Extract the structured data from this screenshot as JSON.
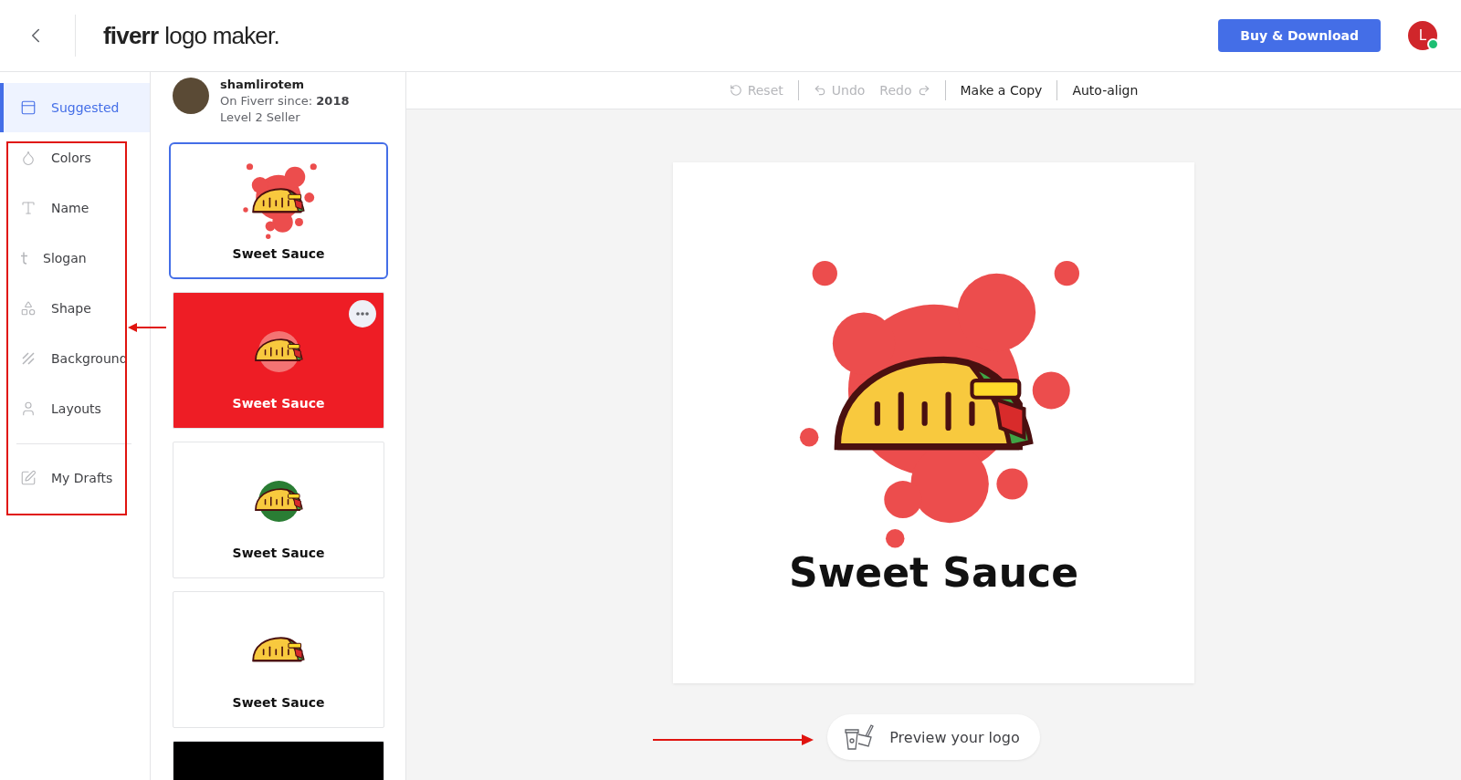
{
  "header": {
    "brand_bold": "fiverr",
    "brand_rest": "logo maker.",
    "buy_button": "Buy & Download",
    "avatar_letter": "L",
    "online": true
  },
  "sidebar": {
    "items": [
      {
        "label": "Suggested",
        "kind": "suggested",
        "selected": true
      },
      {
        "label": "Colors",
        "kind": "colors",
        "selected": false
      },
      {
        "label": "Name",
        "kind": "name",
        "selected": false
      },
      {
        "label": "Slogan",
        "kind": "slogan",
        "selected": false
      },
      {
        "label": "Shape",
        "kind": "shape",
        "selected": false
      },
      {
        "label": "Background",
        "kind": "background",
        "selected": false
      },
      {
        "label": "Layouts",
        "kind": "layouts",
        "selected": false
      },
      {
        "label": "My Drafts",
        "kind": "drafts",
        "selected": false
      }
    ]
  },
  "designer": {
    "username": "shamlirotem",
    "since_label": "On Fiverr since:",
    "since_year": "2018",
    "level": "Level 2 Seller"
  },
  "thumbnails": [
    {
      "name": "Sweet Sauce",
      "kind": "splash",
      "color": "#ffffff",
      "selected": true,
      "menu": false
    },
    {
      "name": "Sweet Sauce",
      "kind": "circle",
      "color": "#ee1d25",
      "selected": false,
      "menu": true
    },
    {
      "name": "Sweet Sauce",
      "kind": "green-circle",
      "color": "#ffffff",
      "selected": false,
      "menu": false
    },
    {
      "name": "Sweet Sauce",
      "kind": "plain",
      "color": "#ffffff",
      "selected": false,
      "menu": false
    },
    {
      "kind": "blank",
      "color": "#000000",
      "selected": false,
      "menu": false
    }
  ],
  "toolbar": [
    [
      {
        "label": "Reset",
        "kind": "reset",
        "disabled": true
      }
    ],
    [
      {
        "label": "Undo",
        "kind": "undo",
        "disabled": true
      },
      {
        "label": "Redo",
        "kind": "redo",
        "disabled": true
      }
    ],
    [
      {
        "label": "Make a Copy",
        "kind": "plain",
        "disabled": false
      }
    ],
    [
      {
        "label": "Auto-align",
        "kind": "plain",
        "disabled": false
      }
    ]
  ],
  "canvas": {
    "logo_name": "Sweet Sauce",
    "preview_button": "Preview your logo"
  }
}
